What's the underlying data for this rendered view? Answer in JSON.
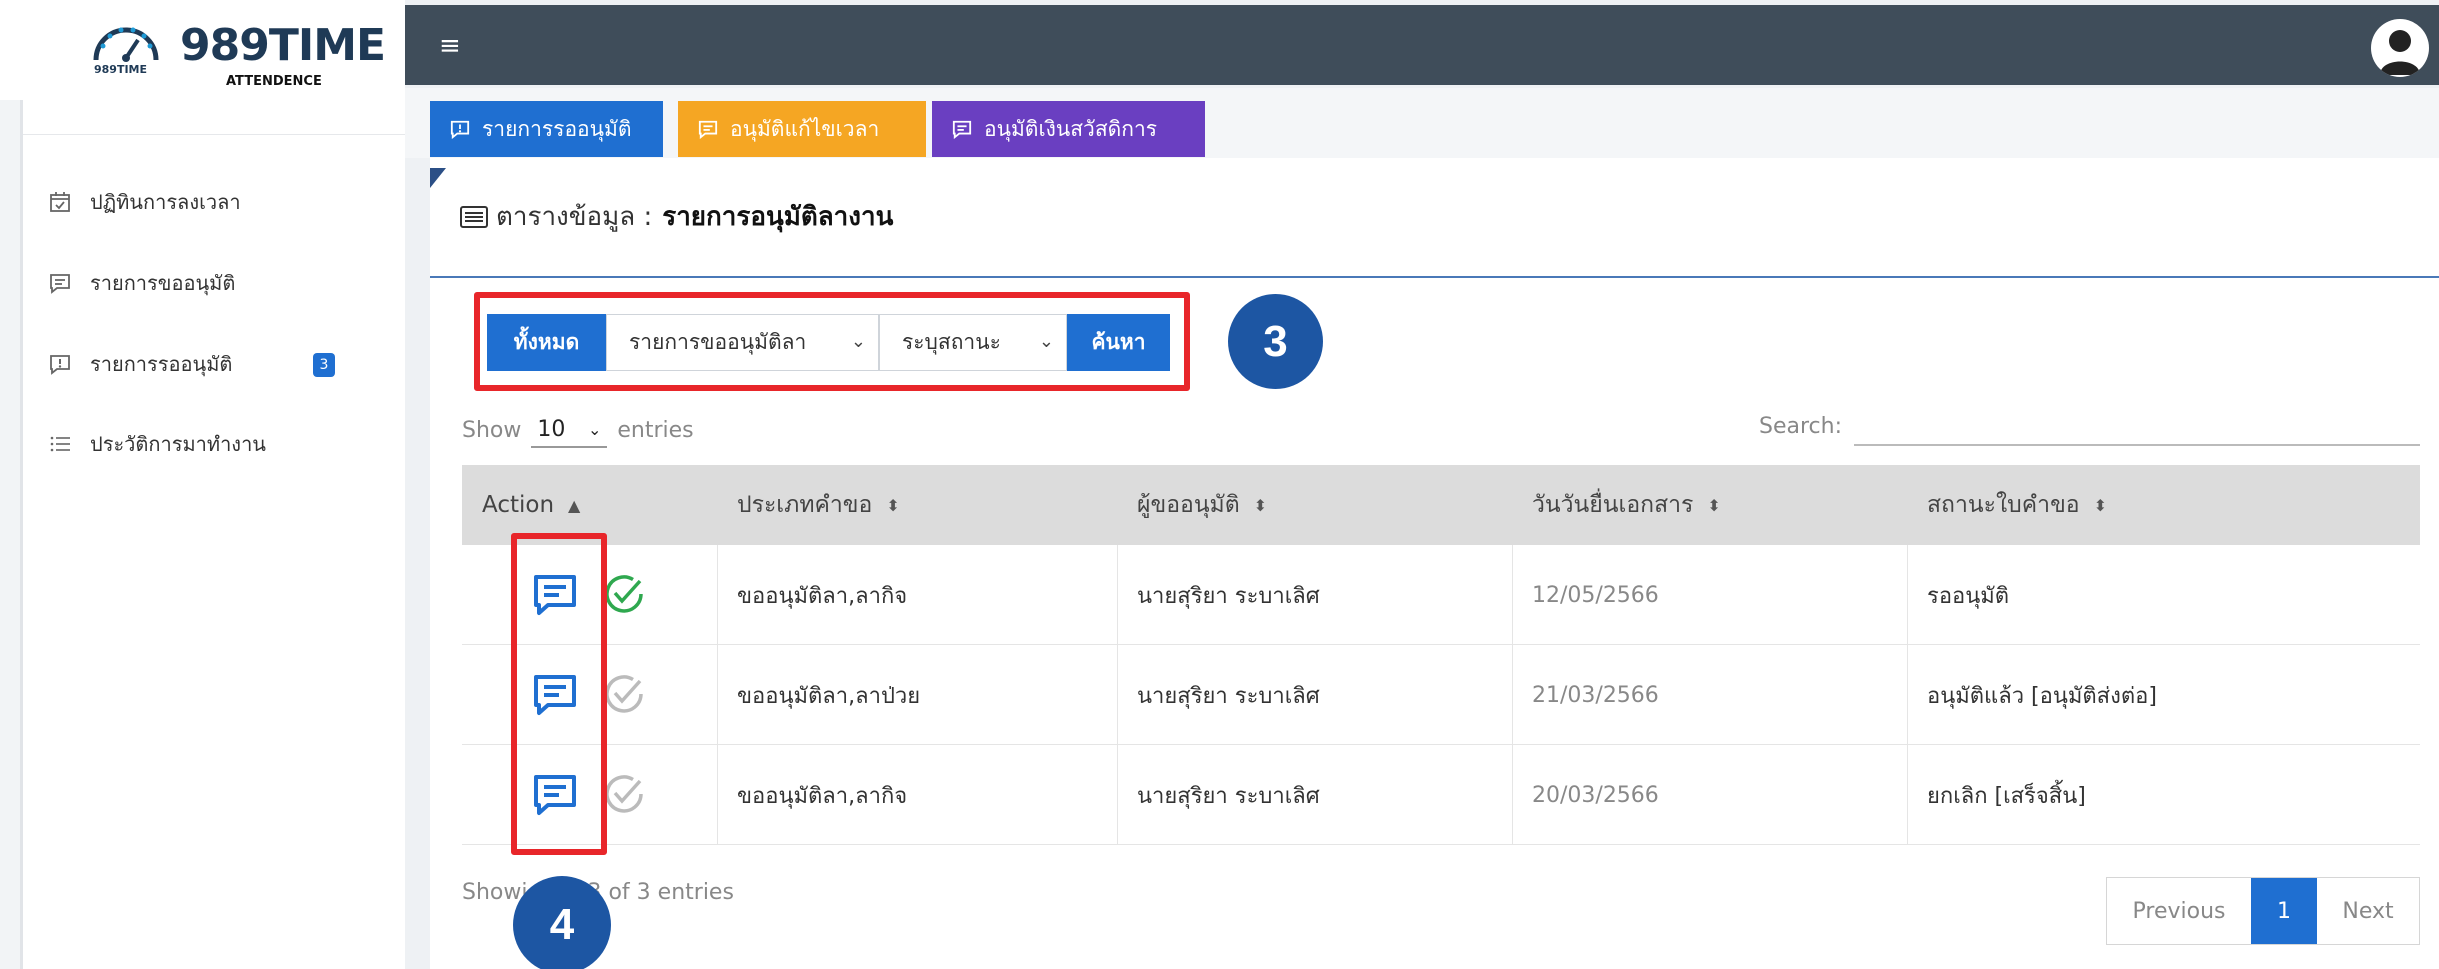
{
  "brand": {
    "title": "989TIME",
    "tagline": "ATTENDENCE",
    "mark_text": "989TIME"
  },
  "sidebar": {
    "items": [
      {
        "label": "ปฏิทินการลงเวลา",
        "icon": "calendar-check-icon"
      },
      {
        "label": "รายการขออนุมัติ",
        "icon": "message-lines-icon"
      },
      {
        "label": "รายการรออนุมัติ",
        "icon": "message-alert-icon",
        "badge": "3"
      },
      {
        "label": "ประวัติการมาทำงาน",
        "icon": "list-icon"
      }
    ]
  },
  "topbar": {
    "menu_icon": "≡",
    "avatar": "user-avatar-icon"
  },
  "tabs": [
    {
      "label": "รายการรออนุมัติ",
      "color": "#1f6fd1",
      "icon": "message-alert-icon"
    },
    {
      "label": "อนุมัติแก้ไขเวลา",
      "color": "#f5a623",
      "icon": "message-lines-icon"
    },
    {
      "label": "อนุมัติเงินสวัสดิการ",
      "color": "#6a3fc1",
      "icon": "message-lines-icon"
    }
  ],
  "page": {
    "title_prefix": "ตารางข้อมูล :",
    "title_main": "รายการอนุมัติลางาน"
  },
  "filter": {
    "all_label": "ทั้งหมด",
    "type_select": "รายการขออนุมัติลา",
    "status_select": "ระบุสถานะ",
    "search_button": "ค้นหา"
  },
  "annotations": {
    "callout_3": "3",
    "callout_4": "4",
    "highlight_color": "#e8262a",
    "callout_color": "#1d56a3"
  },
  "table": {
    "show_label": "Show",
    "page_length": "10",
    "entries_label": "entries",
    "search_label": "Search:",
    "columns": [
      "Action",
      "ประเภทคำขอ",
      "ผู้ขออนุมัติ",
      "วันวันยื่นเอกสาร",
      "สถานะใบคำขอ"
    ],
    "rows": [
      {
        "type": "ขออนุมัติลา,ลากิจ",
        "requester": "นายสุริยา ระบาเลิศ",
        "date": "12/05/2566",
        "status": "รออนุมัติ",
        "checked": true
      },
      {
        "type": "ขออนุมัติลา,ลาป่วย",
        "requester": "นายสุริยา ระบาเลิศ",
        "date": "21/03/2566",
        "status": "อนุมัติแล้ว [อนุมัติส่งต่อ]",
        "checked": false
      },
      {
        "type": "ขออนุมัติลา,ลากิจ",
        "requester": "นายสุริยา ระบาเลิศ",
        "date": "20/03/2566",
        "status": "ยกเลิก [เสร็จสิ้น]",
        "checked": false
      }
    ],
    "info_start": "Showi",
    "info_end": "3 of 3 entries"
  },
  "pagination": {
    "previous": "Previous",
    "current": "1",
    "next": "Next"
  }
}
